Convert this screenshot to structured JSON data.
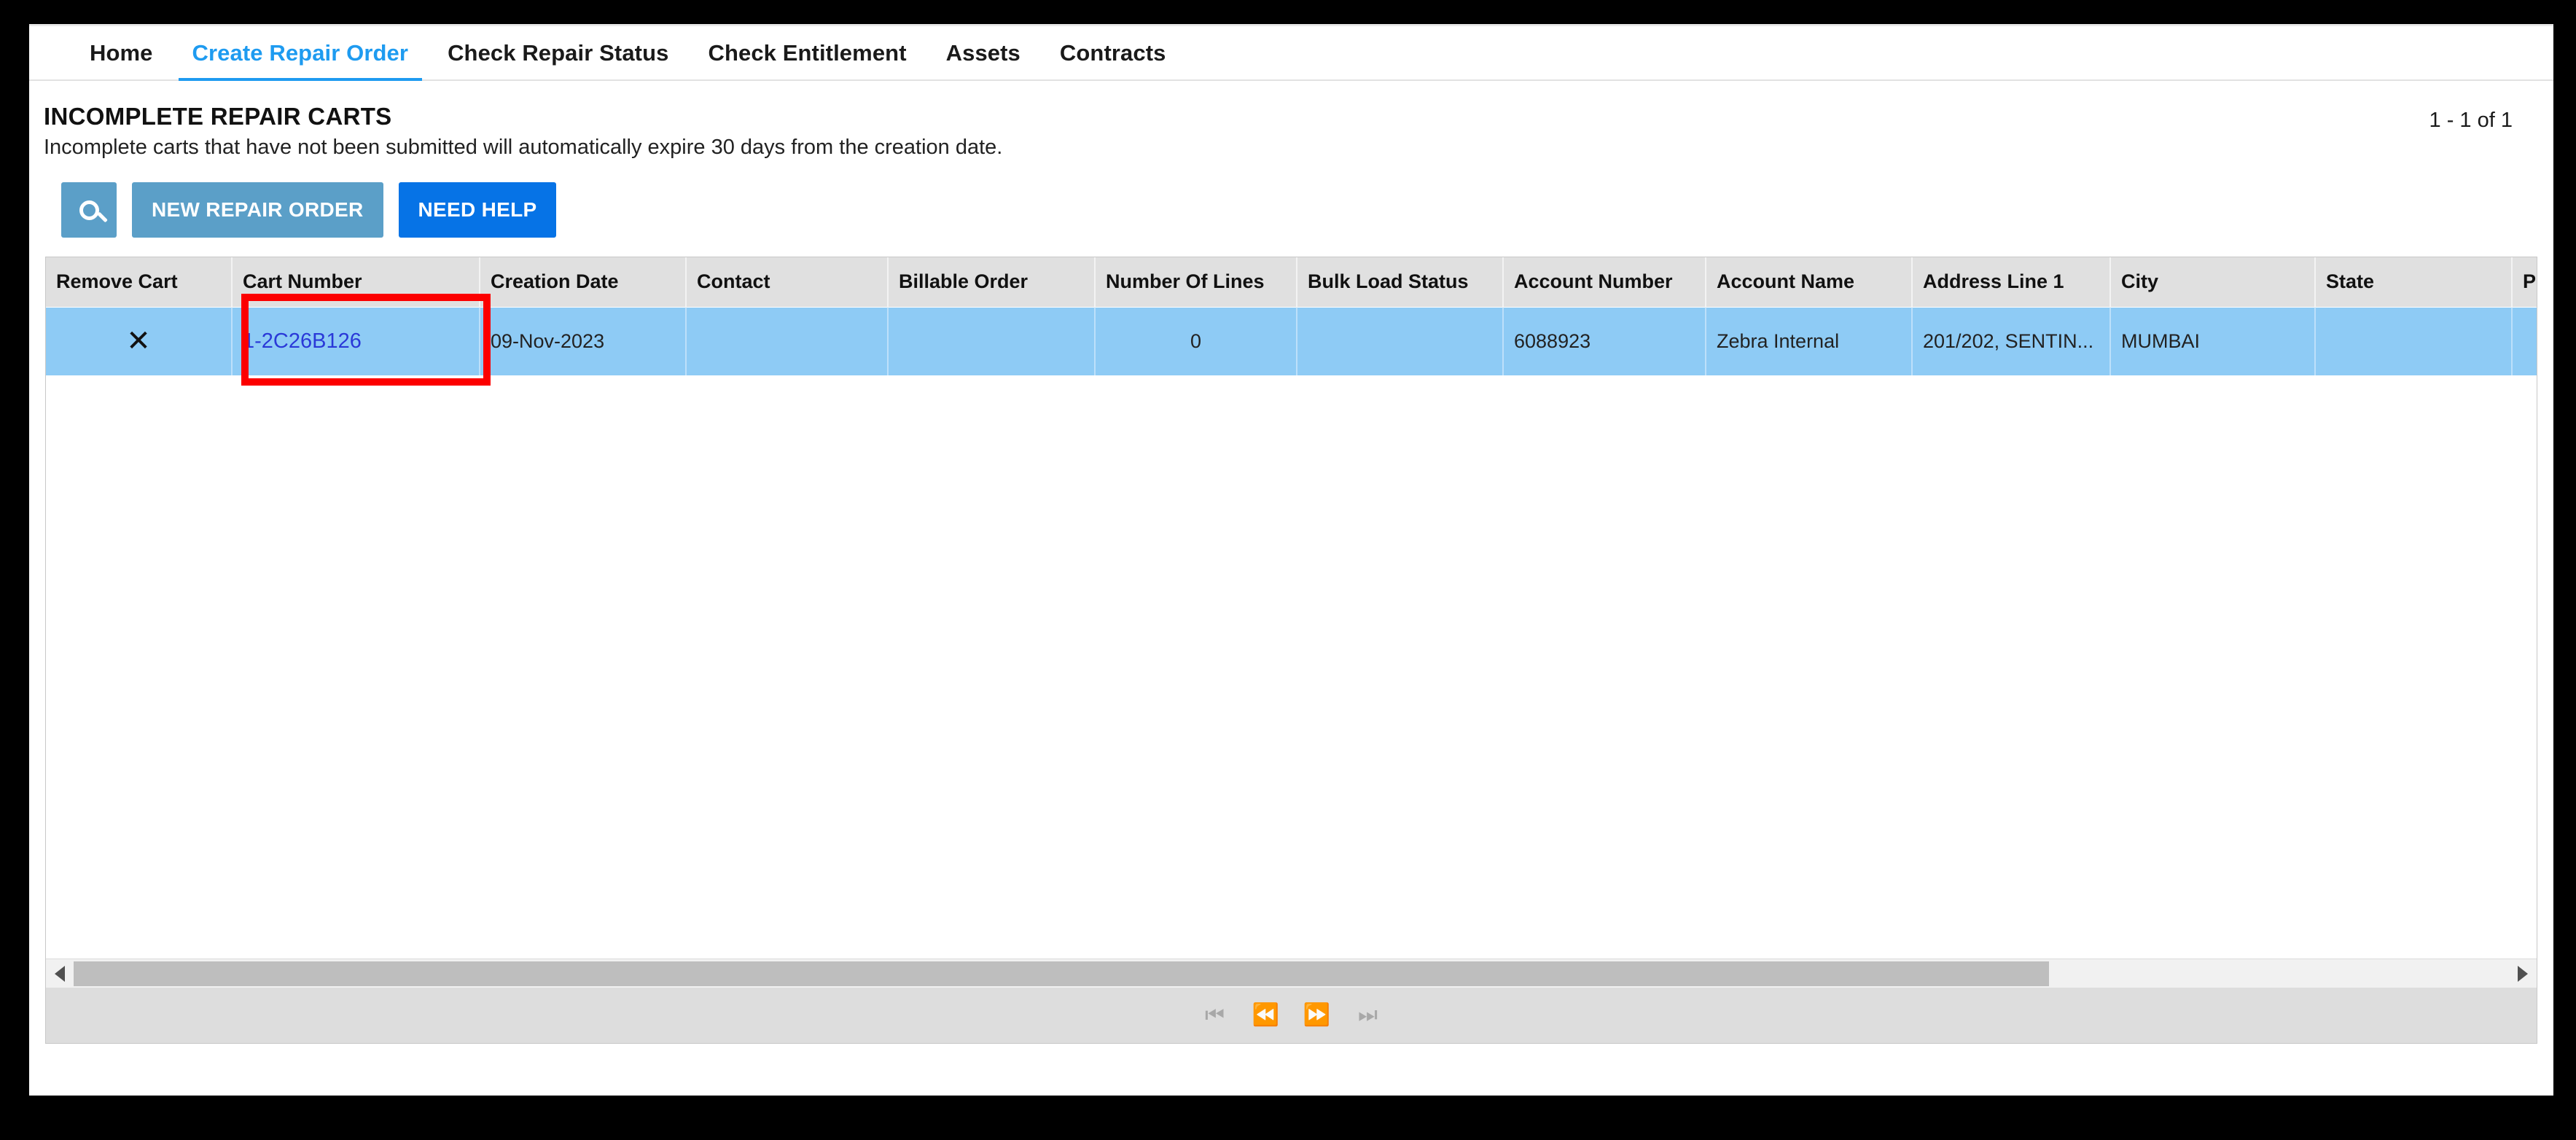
{
  "nav": {
    "tabs": [
      {
        "label": "Home",
        "active": false
      },
      {
        "label": "Create Repair Order",
        "active": true
      },
      {
        "label": "Check Repair Status",
        "active": false
      },
      {
        "label": "Check Entitlement",
        "active": false
      },
      {
        "label": "Assets",
        "active": false
      },
      {
        "label": "Contracts",
        "active": false
      }
    ]
  },
  "header": {
    "title": "INCOMPLETE REPAIR CARTS",
    "subtitle": "Incomplete carts that have not been submitted will automatically expire 30 days from the creation date.",
    "record_count": "1 - 1 of 1"
  },
  "toolbar": {
    "search_icon": "search-icon",
    "new_repair_order_label": "NEW REPAIR ORDER",
    "need_help_label": "NEED HELP",
    "columns_icon": "columns-icon",
    "refresh_icon": "refresh-icon",
    "colors": {
      "muted_blue": "#5b9fc8",
      "primary_blue": "#0673e6",
      "accent_blue": "#1e9bf0",
      "row_selected": "#8ecbf5",
      "header_gray": "#e0e0e0",
      "annotation_red": "#fc0000",
      "link_blue": "#2a39d8"
    }
  },
  "grid": {
    "columns": [
      "Remove Cart",
      "Cart Number",
      "Creation Date",
      "Contact",
      "Billable Order",
      "Number Of Lines",
      "Bulk Load Status",
      "Account Number",
      "Account Name",
      "Address Line 1",
      "City",
      "State",
      "Pro"
    ],
    "rows": [
      {
        "remove_cart": "✕",
        "cart_number": "1-2C26B126",
        "creation_date": "09-Nov-2023",
        "contact": "",
        "billable_order": "",
        "number_of_lines": "0",
        "bulk_load_status": "",
        "account_number": "6088923",
        "account_name": "Zebra Internal",
        "address_line_1": "201/202, SENTIN...",
        "city": "MUMBAI",
        "state": "",
        "province": ""
      }
    ]
  },
  "pager": {
    "first_label": "⏮",
    "prev_label": "⏪",
    "next_label": "⏩",
    "last_label": "⏭"
  },
  "scrollbar": {
    "left_arrow": "scroll-left-arrow",
    "right_arrow": "scroll-right-arrow"
  }
}
